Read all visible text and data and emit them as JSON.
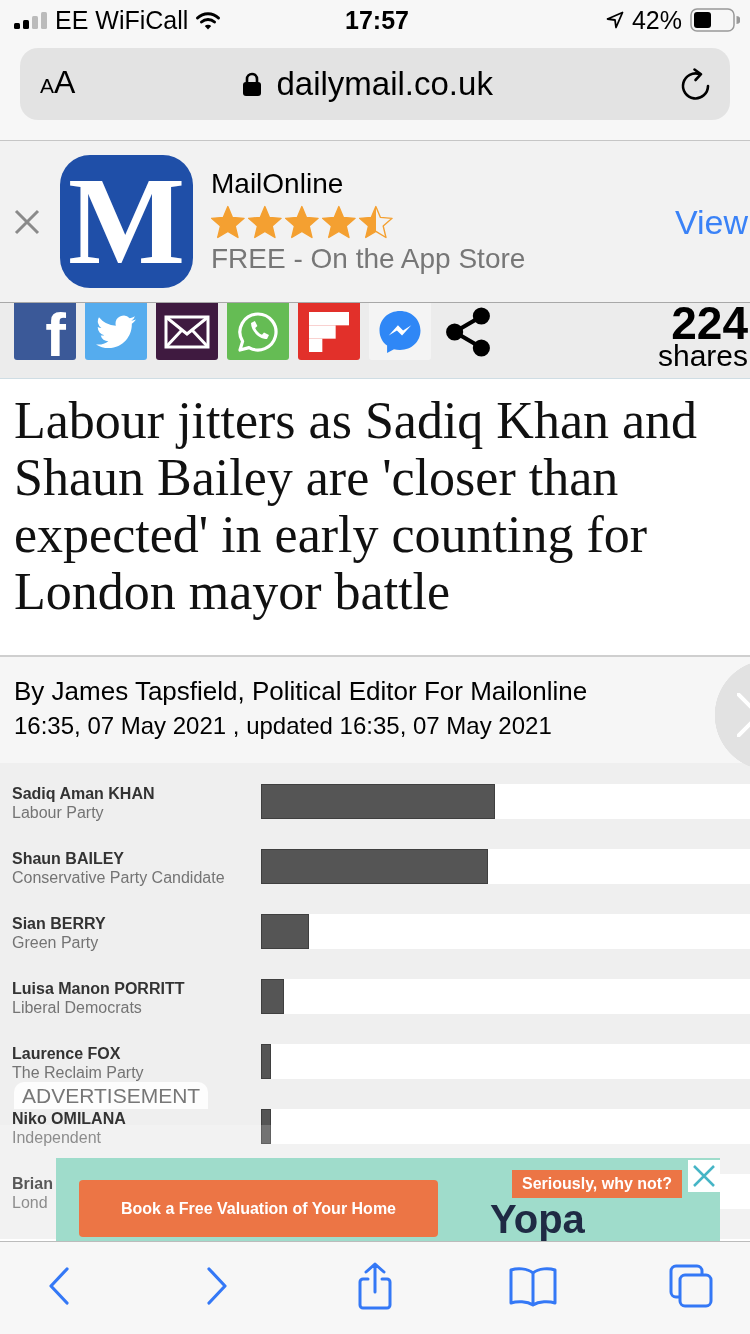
{
  "status_bar": {
    "carrier": "EE WiFiCall",
    "time": "17:57",
    "battery": "42%"
  },
  "address_bar": {
    "text_size": "AA",
    "url": "dailymail.co.uk"
  },
  "app_banner": {
    "app_icon_letter": "M",
    "name": "MailOnline",
    "stars": 4.5,
    "subtitle": "FREE - On the App Store",
    "action": "View"
  },
  "share_bar": {
    "buttons": [
      {
        "kind": "facebook",
        "label": "f"
      },
      {
        "kind": "twitter"
      },
      {
        "kind": "email"
      },
      {
        "kind": "whatsapp"
      },
      {
        "kind": "flipboard"
      },
      {
        "kind": "messenger"
      },
      {
        "kind": "share"
      }
    ],
    "count": "224",
    "count_label": "shares"
  },
  "article": {
    "headline": "Labour jitters as Sadiq Khan and Shaun Bailey are 'closer than expected' in early counting for London mayor battle",
    "byline": "By James Tapsfield, Political Editor For Mailonline",
    "dateline": "16:35, 07 May 2021 , updated 16:35, 07 May 2021"
  },
  "results_graphic": {
    "candidates": [
      {
        "name": "Sadiq Aman KHAN",
        "party": "Labour Party"
      },
      {
        "name": "Shaun BAILEY",
        "party": "Conservative Party Candidate"
      },
      {
        "name": "Sian BERRY",
        "party": "Green Party"
      },
      {
        "name": "Luisa Manon PORRITT",
        "party": "Liberal Democrats"
      },
      {
        "name": "Laurence FOX",
        "party": "The Reclaim Party"
      },
      {
        "name": "Niko OMILANA",
        "party": "Independent"
      },
      {
        "name": "Brian",
        "party": "Lond"
      }
    ]
  },
  "advertisement": {
    "label": "ADVERTISEMENT",
    "button": "Book a Free Valuation of Your Home",
    "tagline": "Seriously, why not?",
    "brand": "Yopa"
  }
}
